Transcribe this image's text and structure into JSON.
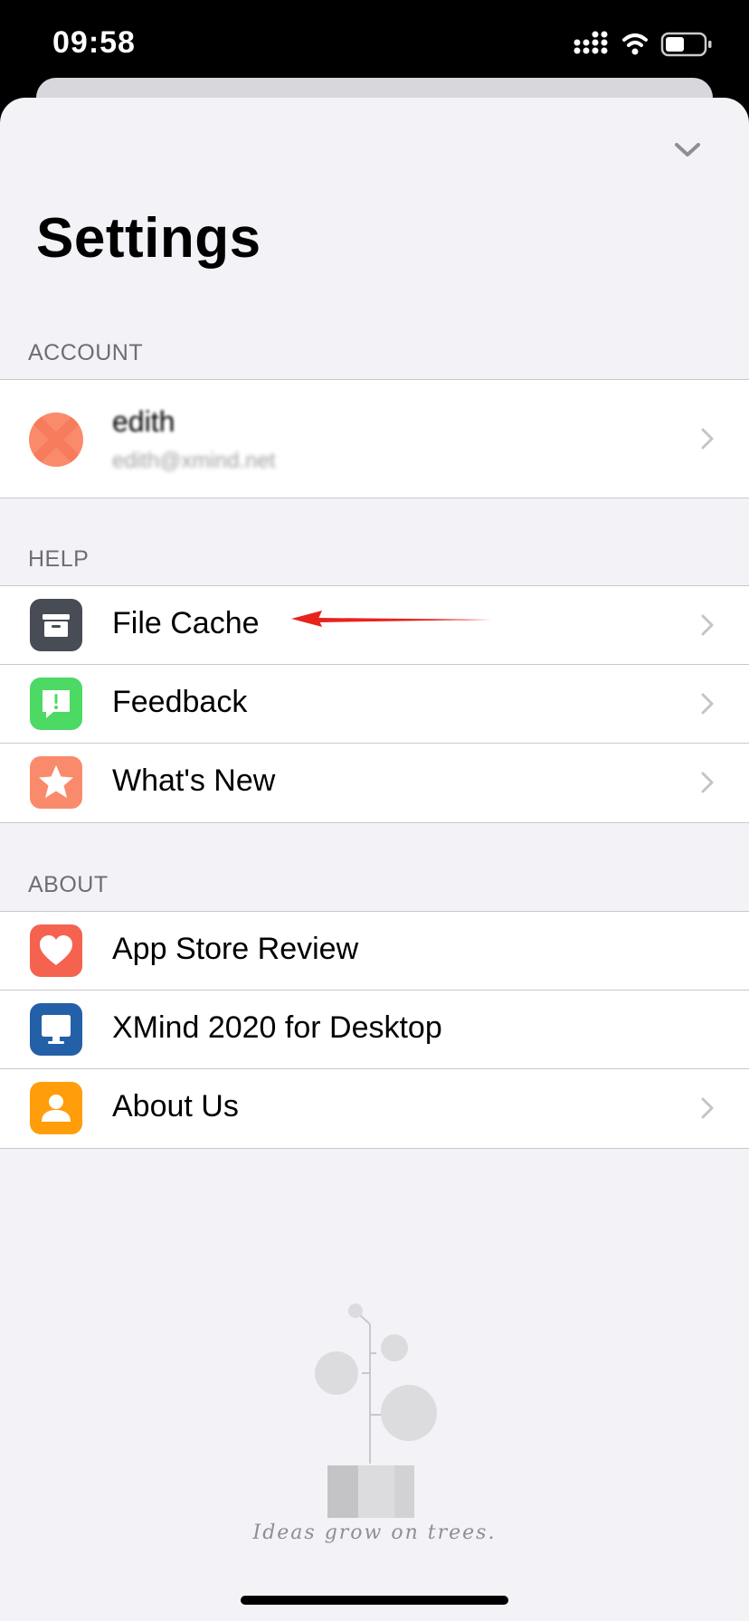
{
  "status_bar": {
    "time": "09:58"
  },
  "header": {
    "title": "Settings",
    "collapse_icon": "chevron-down-icon"
  },
  "account": {
    "header": "ACCOUNT",
    "name": "edith",
    "email": "edith@xmind.net"
  },
  "help": {
    "header": "HELP",
    "items": [
      {
        "label": "File Cache",
        "icon": "archive-box-icon",
        "color": "#474c55"
      },
      {
        "label": "Feedback",
        "icon": "message-alert-icon",
        "color": "#4cd964"
      },
      {
        "label": "What's New",
        "icon": "star-icon",
        "color": "#f98b6c"
      }
    ]
  },
  "about": {
    "header": "ABOUT",
    "items": [
      {
        "label": "App Store Review",
        "icon": "heart-icon",
        "color": "#f5624f"
      },
      {
        "label": "XMind 2020 for Desktop",
        "icon": "desktop-monitor-icon",
        "color": "#2460a7"
      },
      {
        "label": "About Us",
        "icon": "person-icon",
        "color": "#ff9d0a"
      }
    ]
  },
  "footer": {
    "tagline": "Ideas grow on trees."
  },
  "colors": {
    "background": "#f2f2f7",
    "annotation_arrow": "#e8231d"
  }
}
